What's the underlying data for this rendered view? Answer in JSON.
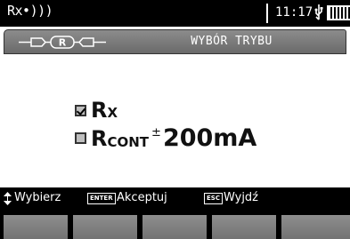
{
  "status_bar": {
    "mode": "Rx•)))",
    "time": "11:17",
    "icons": [
      "usb-icon",
      "battery-icon"
    ]
  },
  "title_bar": {
    "icon": "cable-probe-icon",
    "icon_label": "R",
    "title": "WYBÓR TRYBU"
  },
  "options": [
    {
      "label": "R",
      "subscript": "X",
      "checked": true
    },
    {
      "label": "R",
      "subscript": "CONT",
      "prefix": "±",
      "value": "200mA",
      "checked": false
    }
  ],
  "hints": {
    "select_icon": "up-down-arrows-icon",
    "select_label": "Wybierz",
    "enter_key": "ENTER",
    "accept_label": "Akceptuj",
    "esc_key": "ESC",
    "exit_label": "Wyjdź"
  },
  "colors": {
    "bars": "#000000",
    "title_bar": "#7c7c7c",
    "soft_key": "#808080"
  }
}
